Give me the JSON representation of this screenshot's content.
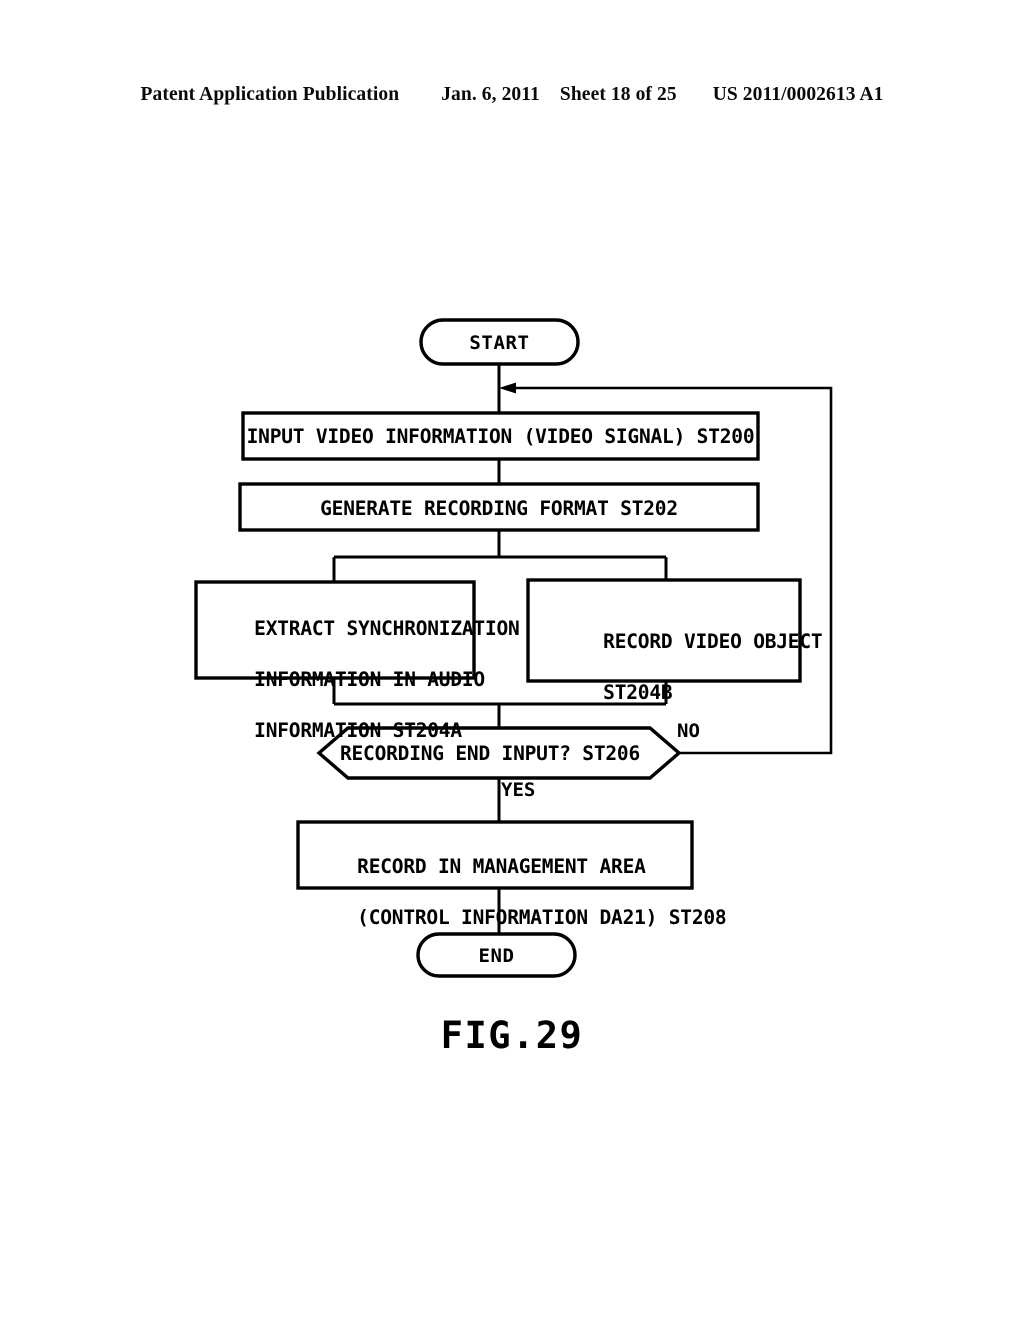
{
  "header": {
    "publication": "Patent Application Publication",
    "date": "Jan. 6, 2011",
    "sheet": "Sheet 18 of 25",
    "patent_number": "US 2011/0002613 A1"
  },
  "figure": {
    "caption": "FIG.29",
    "nodes": {
      "start": "START",
      "st200": "INPUT VIDEO INFORMATION (VIDEO SIGNAL) ST200",
      "st202": "GENERATE RECORDING FORMAT ST202",
      "st204a_line1": "EXTRACT SYNCHRONIZATION",
      "st204a_line2": "INFORMATION IN AUDIO",
      "st204a_line3": "INFORMATION ST204A",
      "st204b_line1": "RECORD VIDEO OBJECT",
      "st204b_line2": "ST204B",
      "st206": "RECORDING END INPUT? ST206",
      "st208_line1": "RECORD IN MANAGEMENT AREA",
      "st208_line2": "(CONTROL INFORMATION DA21) ST208",
      "end": "END"
    },
    "branches": {
      "no": "NO",
      "yes": "YES"
    },
    "colors": {
      "stroke": "#000000",
      "fill": "#ffffff",
      "page": "#ffffff"
    }
  }
}
